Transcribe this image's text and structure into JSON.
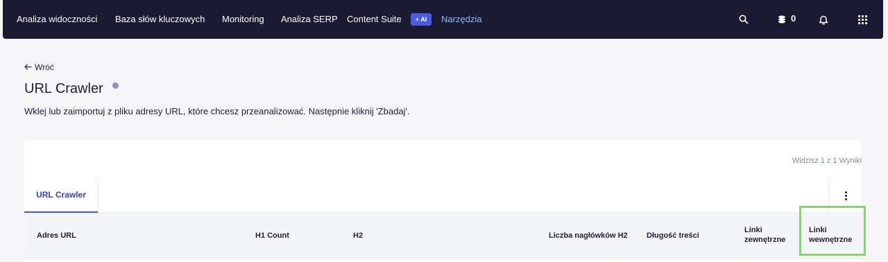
{
  "nav": {
    "items": [
      "Analiza widoczności",
      "Baza słów kluczowych",
      "Monitoring",
      "Analiza SERP",
      "Content Suite",
      "Narzędzia"
    ],
    "ai_badge": "+ AI",
    "credits": "0",
    "icons": [
      "search-icon",
      "coins-icon",
      "bell-icon",
      "apps-grid-icon"
    ]
  },
  "page": {
    "back": "Wróć",
    "title": "URL Crawler",
    "description": "Wklej lub zaimportuj z pliku adresy URL, które chcesz przeanalizować. Następnie kliknij 'Zbadaj'."
  },
  "results": {
    "prefix": "Widzisz",
    "shown": "1",
    "of": "z",
    "total": "1",
    "suffix": "Wyniki"
  },
  "tab": "URL Crawler",
  "table": {
    "columns": [
      "Adres URL",
      "H1 Count",
      "H2",
      "Liczba nagłówków H2",
      "Długość treści",
      "Linki zewnętrzne",
      "Linki wewnętrzne"
    ]
  },
  "colors": {
    "topbar": "#1b1a33",
    "accent": "#4a56d8",
    "highlight": "#8bd46a",
    "nav_active": "#8fb8ff"
  }
}
